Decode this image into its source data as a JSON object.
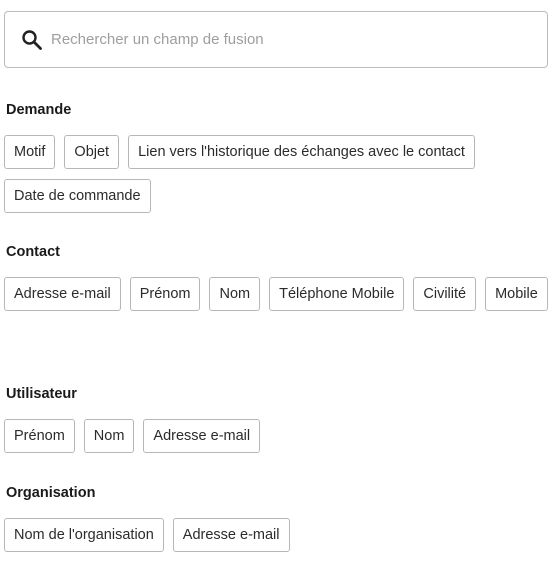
{
  "search": {
    "placeholder": "Rechercher un champ de fusion",
    "value": "",
    "icon": "search-icon"
  },
  "sections": [
    {
      "title": "Demande",
      "chips": [
        "Motif",
        "Objet",
        "Lien vers l'historique des échanges avec le contact",
        "Date de commande"
      ]
    },
    {
      "title": "Contact",
      "chips": [
        "Adresse e-mail",
        "Prénom",
        "Nom",
        "Téléphone Mobile",
        "Civilité",
        "Mobile"
      ]
    },
    {
      "title": "Utilisateur",
      "chips": [
        "Prénom",
        "Nom",
        "Adresse e-mail"
      ]
    },
    {
      "title": "Organisation",
      "chips": [
        "Nom de l'organisation",
        "Adresse e-mail"
      ]
    }
  ]
}
